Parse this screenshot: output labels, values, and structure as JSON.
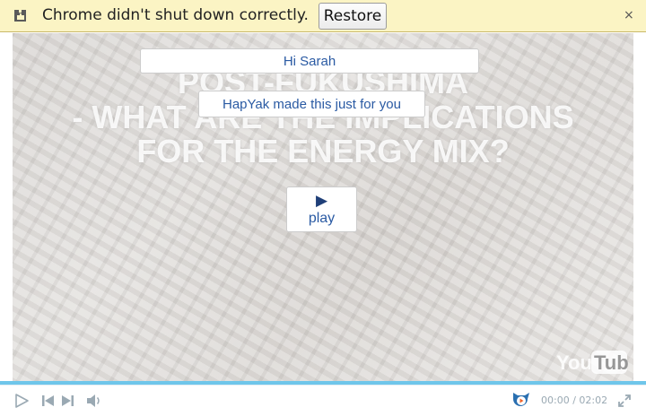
{
  "infobar": {
    "message": "Chrome didn't shut down correctly.",
    "restore_label": "Restore",
    "close_glyph": "×",
    "icon": "puzzle-icon"
  },
  "video": {
    "background_title_lines": [
      "POST-FUKUSHIMA",
      "- WHAT ARE THE IMPLICATIONS",
      "FOR THE ENERGY MIX?"
    ],
    "greeting": "Hi Sarah",
    "made_for": "HapYak made this just for you",
    "play_glyph": "▶",
    "play_label": "play",
    "watermark": "YouTube"
  },
  "player": {
    "progress_fraction": 0.0,
    "time_current": "00:00",
    "time_separator": "/",
    "time_total": "02:02",
    "accent_color": "#37b1e2",
    "icons": [
      "play-icon",
      "previous-icon",
      "next-icon",
      "volume-icon",
      "hapyak-logo-icon",
      "fullscreen-icon"
    ]
  }
}
